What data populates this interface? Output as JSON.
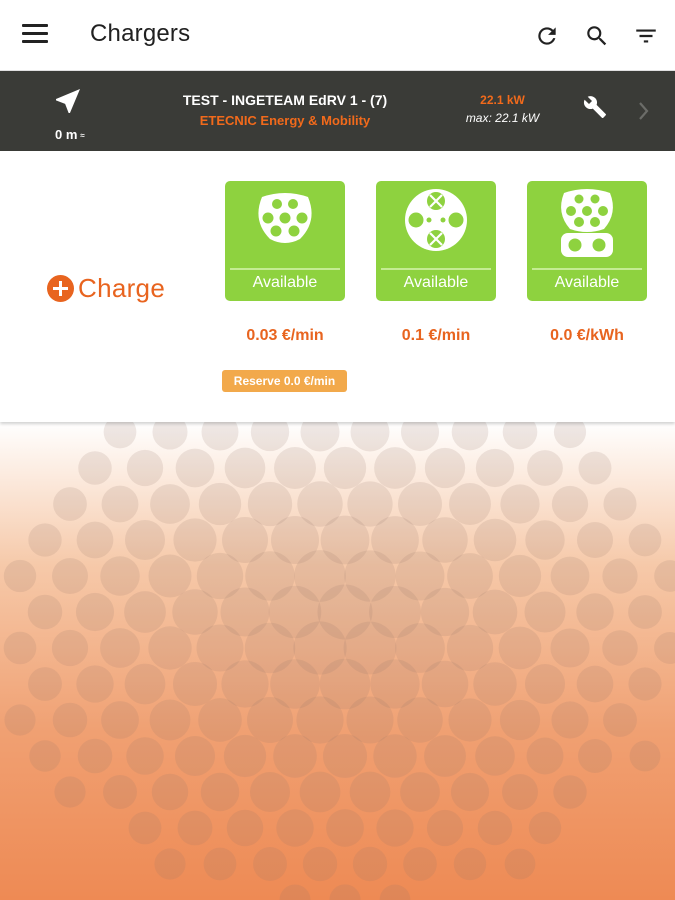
{
  "app_bar": {
    "title": "Chargers",
    "icons": [
      "menu-icon",
      "refresh-icon",
      "search-icon",
      "filter-icon"
    ]
  },
  "charger": {
    "distance": "0 m",
    "distance_suffix": "≈",
    "name": "TEST - INGETEAM EdRV 1 - (7)",
    "operator": "ETECNIC Energy & Mobility",
    "power": "22.1 kW",
    "max_power": "max: 22.1 kW"
  },
  "charge_button": {
    "label": "Charge"
  },
  "connectors": [
    {
      "type_icon": "type2-socket-icon",
      "status": "Available",
      "price": "0.03 €/min"
    },
    {
      "type_icon": "chademo-socket-icon",
      "status": "Available",
      "price": "0.1 €/min"
    },
    {
      "type_icon": "ccs-combo-socket-icon",
      "status": "Available",
      "price": "0.0 €/kWh"
    }
  ],
  "reserve": {
    "label": "Reserve 0.0 €/min"
  },
  "colors": {
    "accent_orange": "#e8641f",
    "available_green": "#8ed23f",
    "header_dark": "#3a3b37",
    "reserve_orange": "#f2a94b"
  }
}
